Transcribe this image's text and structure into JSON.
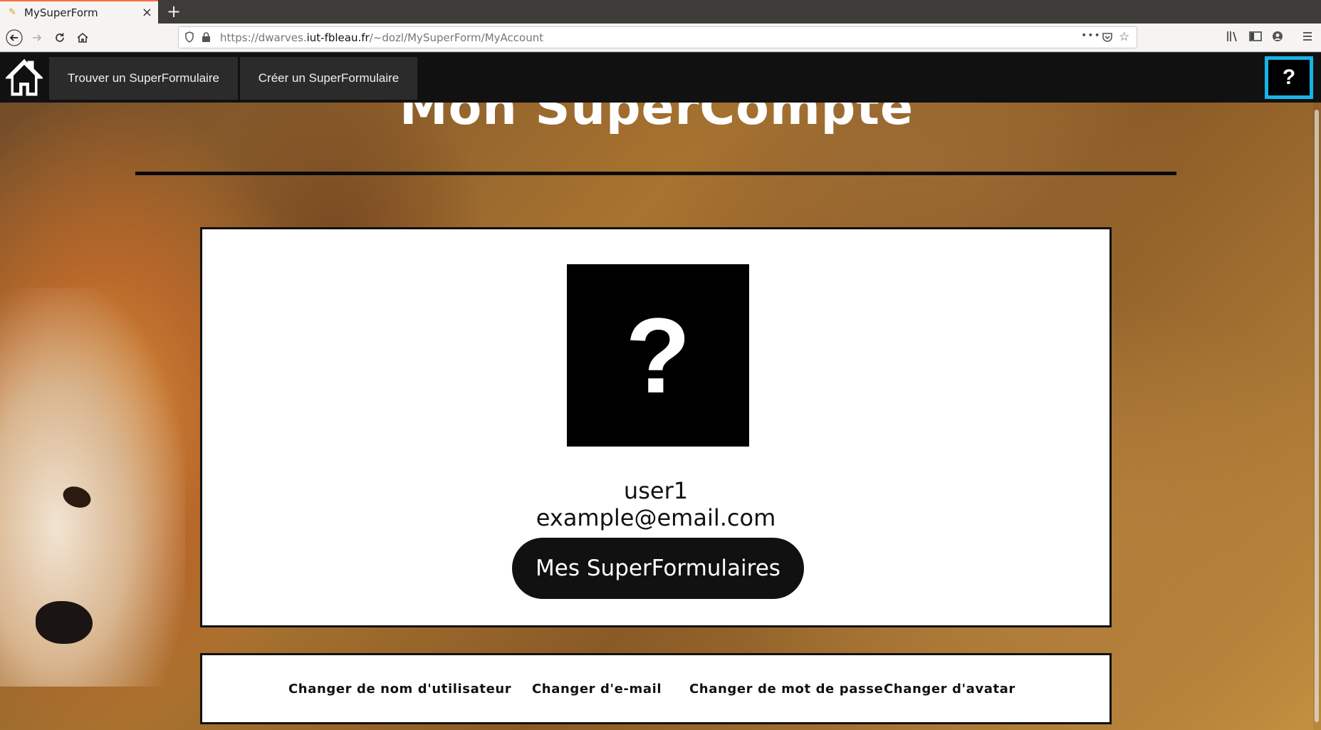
{
  "browser": {
    "tab_title": "MySuperForm",
    "tab_close": "×",
    "new_tab": "+",
    "url_prefix": "https://dwarves.",
    "url_domain": "iut-fbleau.fr",
    "url_path": "/~dozl/MySuperForm/MyAccount",
    "url_more": "•••"
  },
  "nav": {
    "find_label": "Trouver un SuperFormulaire",
    "create_label": "Créer un SuperFormulaire",
    "help_label": "?"
  },
  "page": {
    "title": "Mon SuperCompte"
  },
  "profile": {
    "avatar_glyph": "?",
    "username": "user1",
    "email": "example@email.com",
    "my_forms_label": "Mes SuperFormulaires"
  },
  "settings": {
    "change_username": "Changer de nom d'utilisateur",
    "change_email": "Changer d'e-mail",
    "change_password": "Changer de mot de passe",
    "change_avatar": "Changer d'avatar"
  },
  "colors": {
    "help_border": "#19b3e6",
    "nav_bg": "#111111",
    "tab_accent": "#ff6b3d"
  }
}
